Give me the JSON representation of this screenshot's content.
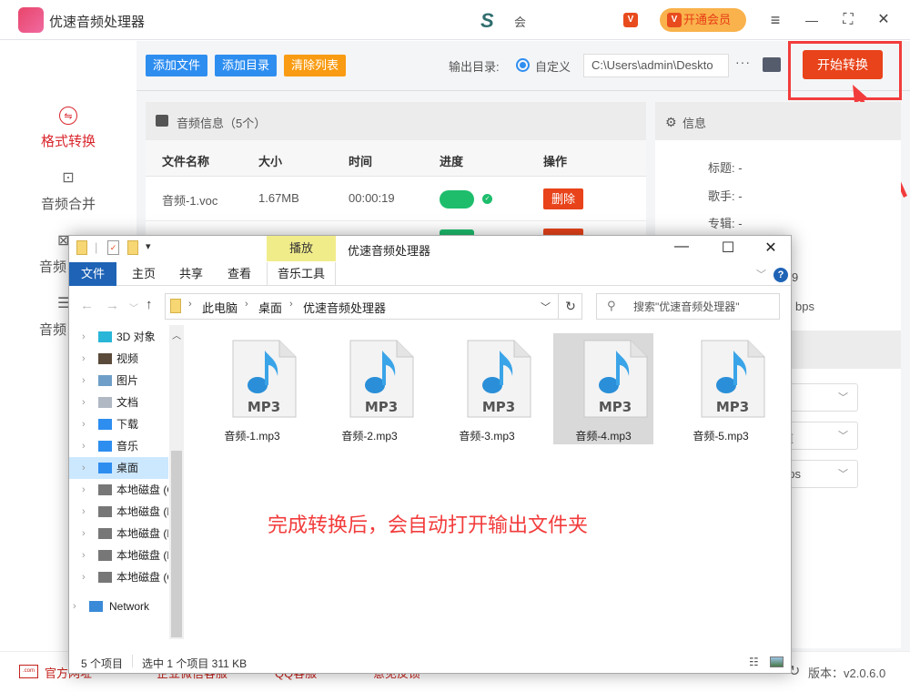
{
  "app": {
    "title": "优速音频处理器",
    "user_name": "会",
    "vip_badge": "V",
    "vip_button": "开通会员",
    "window_controls": {
      "menu": "≡",
      "minimize": "—",
      "fullscreen": "⛶",
      "close": "✕"
    }
  },
  "sidebar": {
    "items": [
      {
        "label": "格式转换",
        "icon": "⇋",
        "active": true
      },
      {
        "label": "音频合并",
        "icon": "⊡",
        "active": false
      },
      {
        "label": "音频",
        "icon": "⊠",
        "active": false
      },
      {
        "label": "音频",
        "icon": "☰",
        "active": false
      }
    ]
  },
  "toolbar": {
    "add_file": "添加文件",
    "add_dir": "添加目录",
    "clear_list": "清除列表",
    "output_label": "输出目录:",
    "radio_label": "自定义",
    "output_path": "C:\\Users\\admin\\Deskto",
    "more": "···",
    "start": "开始转换"
  },
  "audio_panel": {
    "title": "音频信息（5个）",
    "columns": [
      "文件名称",
      "大小",
      "时间",
      "进度",
      "操作"
    ],
    "rows": [
      {
        "name": "音频-1.voc",
        "size": "1.67MB",
        "time": "00:00:19",
        "progress": 1.0,
        "action": "删除"
      }
    ]
  },
  "info_panel": {
    "title": "信息",
    "fields": [
      {
        "label": "标题:",
        "value": "-"
      },
      {
        "label": "歌手:",
        "value": "-"
      },
      {
        "label": "专辑:",
        "value": "-"
      }
    ],
    "partial_values": [
      "9",
      "bps"
    ],
    "selects": [
      "",
      "道",
      "bps"
    ]
  },
  "footer": {
    "links": [
      "官方网址",
      "企业微信客服",
      "QQ客服",
      "意见反馈"
    ],
    "version": "版本：v2.0.6.0"
  },
  "explorer": {
    "title": "优速音频处理器",
    "play_tab": "播放",
    "ribbon_tabs": [
      "文件",
      "主页",
      "共享",
      "查看",
      "音乐工具"
    ],
    "breadcrumb": [
      "此电脑",
      "桌面",
      "优速音频处理器"
    ],
    "search_placeholder": "搜索\"优速音频处理器\"",
    "tree": [
      {
        "label": "3D 对象",
        "color": "#29b6d8"
      },
      {
        "label": "视频",
        "color": "#5a4a3a"
      },
      {
        "label": "图片",
        "color": "#6f9fc8"
      },
      {
        "label": "文档",
        "color": "#b0b8c4"
      },
      {
        "label": "下载",
        "color": "#2e8ef0"
      },
      {
        "label": "音乐",
        "color": "#2e8ef0"
      },
      {
        "label": "桌面",
        "color": "#2e8ef0",
        "selected": true
      },
      {
        "label": "本地磁盘 (C",
        "color": "#777"
      },
      {
        "label": "本地磁盘 (D",
        "color": "#777"
      },
      {
        "label": "本地磁盘 (E",
        "color": "#777"
      },
      {
        "label": "本地磁盘 (F",
        "color": "#777"
      },
      {
        "label": "本地磁盘 (G",
        "color": "#777"
      },
      {
        "label": "Network",
        "color": "#3a8ad8"
      }
    ],
    "files": [
      {
        "name": "音频-1.mp3",
        "selected": false
      },
      {
        "name": "音频-2.mp3",
        "selected": false
      },
      {
        "name": "音频-3.mp3",
        "selected": false
      },
      {
        "name": "音频-4.mp3",
        "selected": true
      },
      {
        "name": "音频-5.mp3",
        "selected": false
      }
    ],
    "file_icon_label": "MP3",
    "status_count": "5 个项目",
    "status_selected": "选中 1 个项目  311 KB"
  },
  "annotation": "完成转换后，会自动打开输出文件夹",
  "colors": {
    "accent_blue": "#2e8ef0",
    "accent_orange": "#f99c13",
    "start_red": "#e8431a",
    "highlight": "#f23c3c",
    "progress_green": "#1dbd6c"
  }
}
